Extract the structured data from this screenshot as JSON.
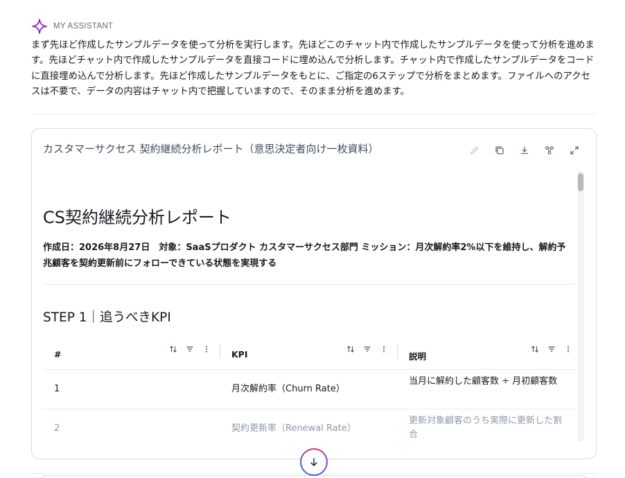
{
  "assistant": {
    "name": "MY ASSISTANT",
    "icon": "sparkle-icon",
    "accent": "#b026b0",
    "message": "まず先ほど作成したサンプルデータを使って分析を実行します。先ほどこのチャット内で作成したサンプルデータを使って分析を進めます。先ほどチャット内で作成したサンプルデータを直接コードに埋め込んで分析します。チャット内で作成したサンプルデータをコードに直接埋め込んで分析します。先ほど作成したサンプルデータをもとに、ご指定の6ステップで分析をまとめます。ファイルへのアクセスは不要で、データの内容はチャット内で把握していますので、そのまま分析を進めます。"
  },
  "artifact": {
    "title": "カスタマーサクセス 契約継続分析レポート（意思決定者向け一枚資料）",
    "actions": [
      "edit-icon",
      "copy-icon",
      "download-icon",
      "share-icon",
      "expand-icon"
    ],
    "doc": {
      "title": "CS契約継続分析レポート",
      "meta": "作成日：2026年8月27日　対象：SaaSプロダクト カスタマーサクセス部門 ミッション：月次解約率2%以下を維持し、解約予兆顧客を契約更新前にフォローできている状態を実現する",
      "step_heading": "STEP 1｜追うべきKPI",
      "table": {
        "columns": [
          "#",
          "KPI",
          "説明"
        ],
        "rows": [
          {
            "num": "1",
            "kpi": "月次解約率（Churn Rate）",
            "desc": "当月に解約した顧客数 ÷ 月初顧客数"
          },
          {
            "num": "2",
            "kpi": "契約更新率（Renewal Rate）",
            "desc": "更新対象顧客のうち実際に更新した割合"
          }
        ]
      }
    }
  },
  "scroll_button": {
    "icon": "arrow-down-icon"
  }
}
